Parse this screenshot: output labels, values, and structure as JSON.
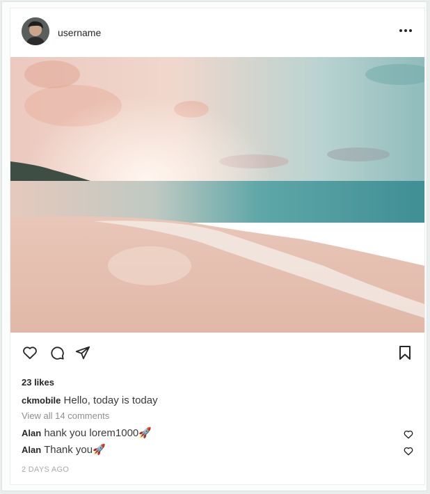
{
  "post": {
    "username": "username",
    "likes": "23 likes",
    "caption": {
      "user": "ckmobile",
      "text": "Hello, today is today"
    },
    "view_all": "View all 14 comments",
    "comments": [
      {
        "user": "Alan",
        "text": "hank you lorem1000🚀"
      },
      {
        "user": "Alan",
        "text": "Thank you🚀"
      }
    ],
    "timestamp": "2 DAYS AGO"
  },
  "icons": {
    "more": "more-horizontal-icon",
    "like": "heart-icon",
    "comment": "comment-icon",
    "share": "send-icon",
    "save": "bookmark-icon"
  }
}
